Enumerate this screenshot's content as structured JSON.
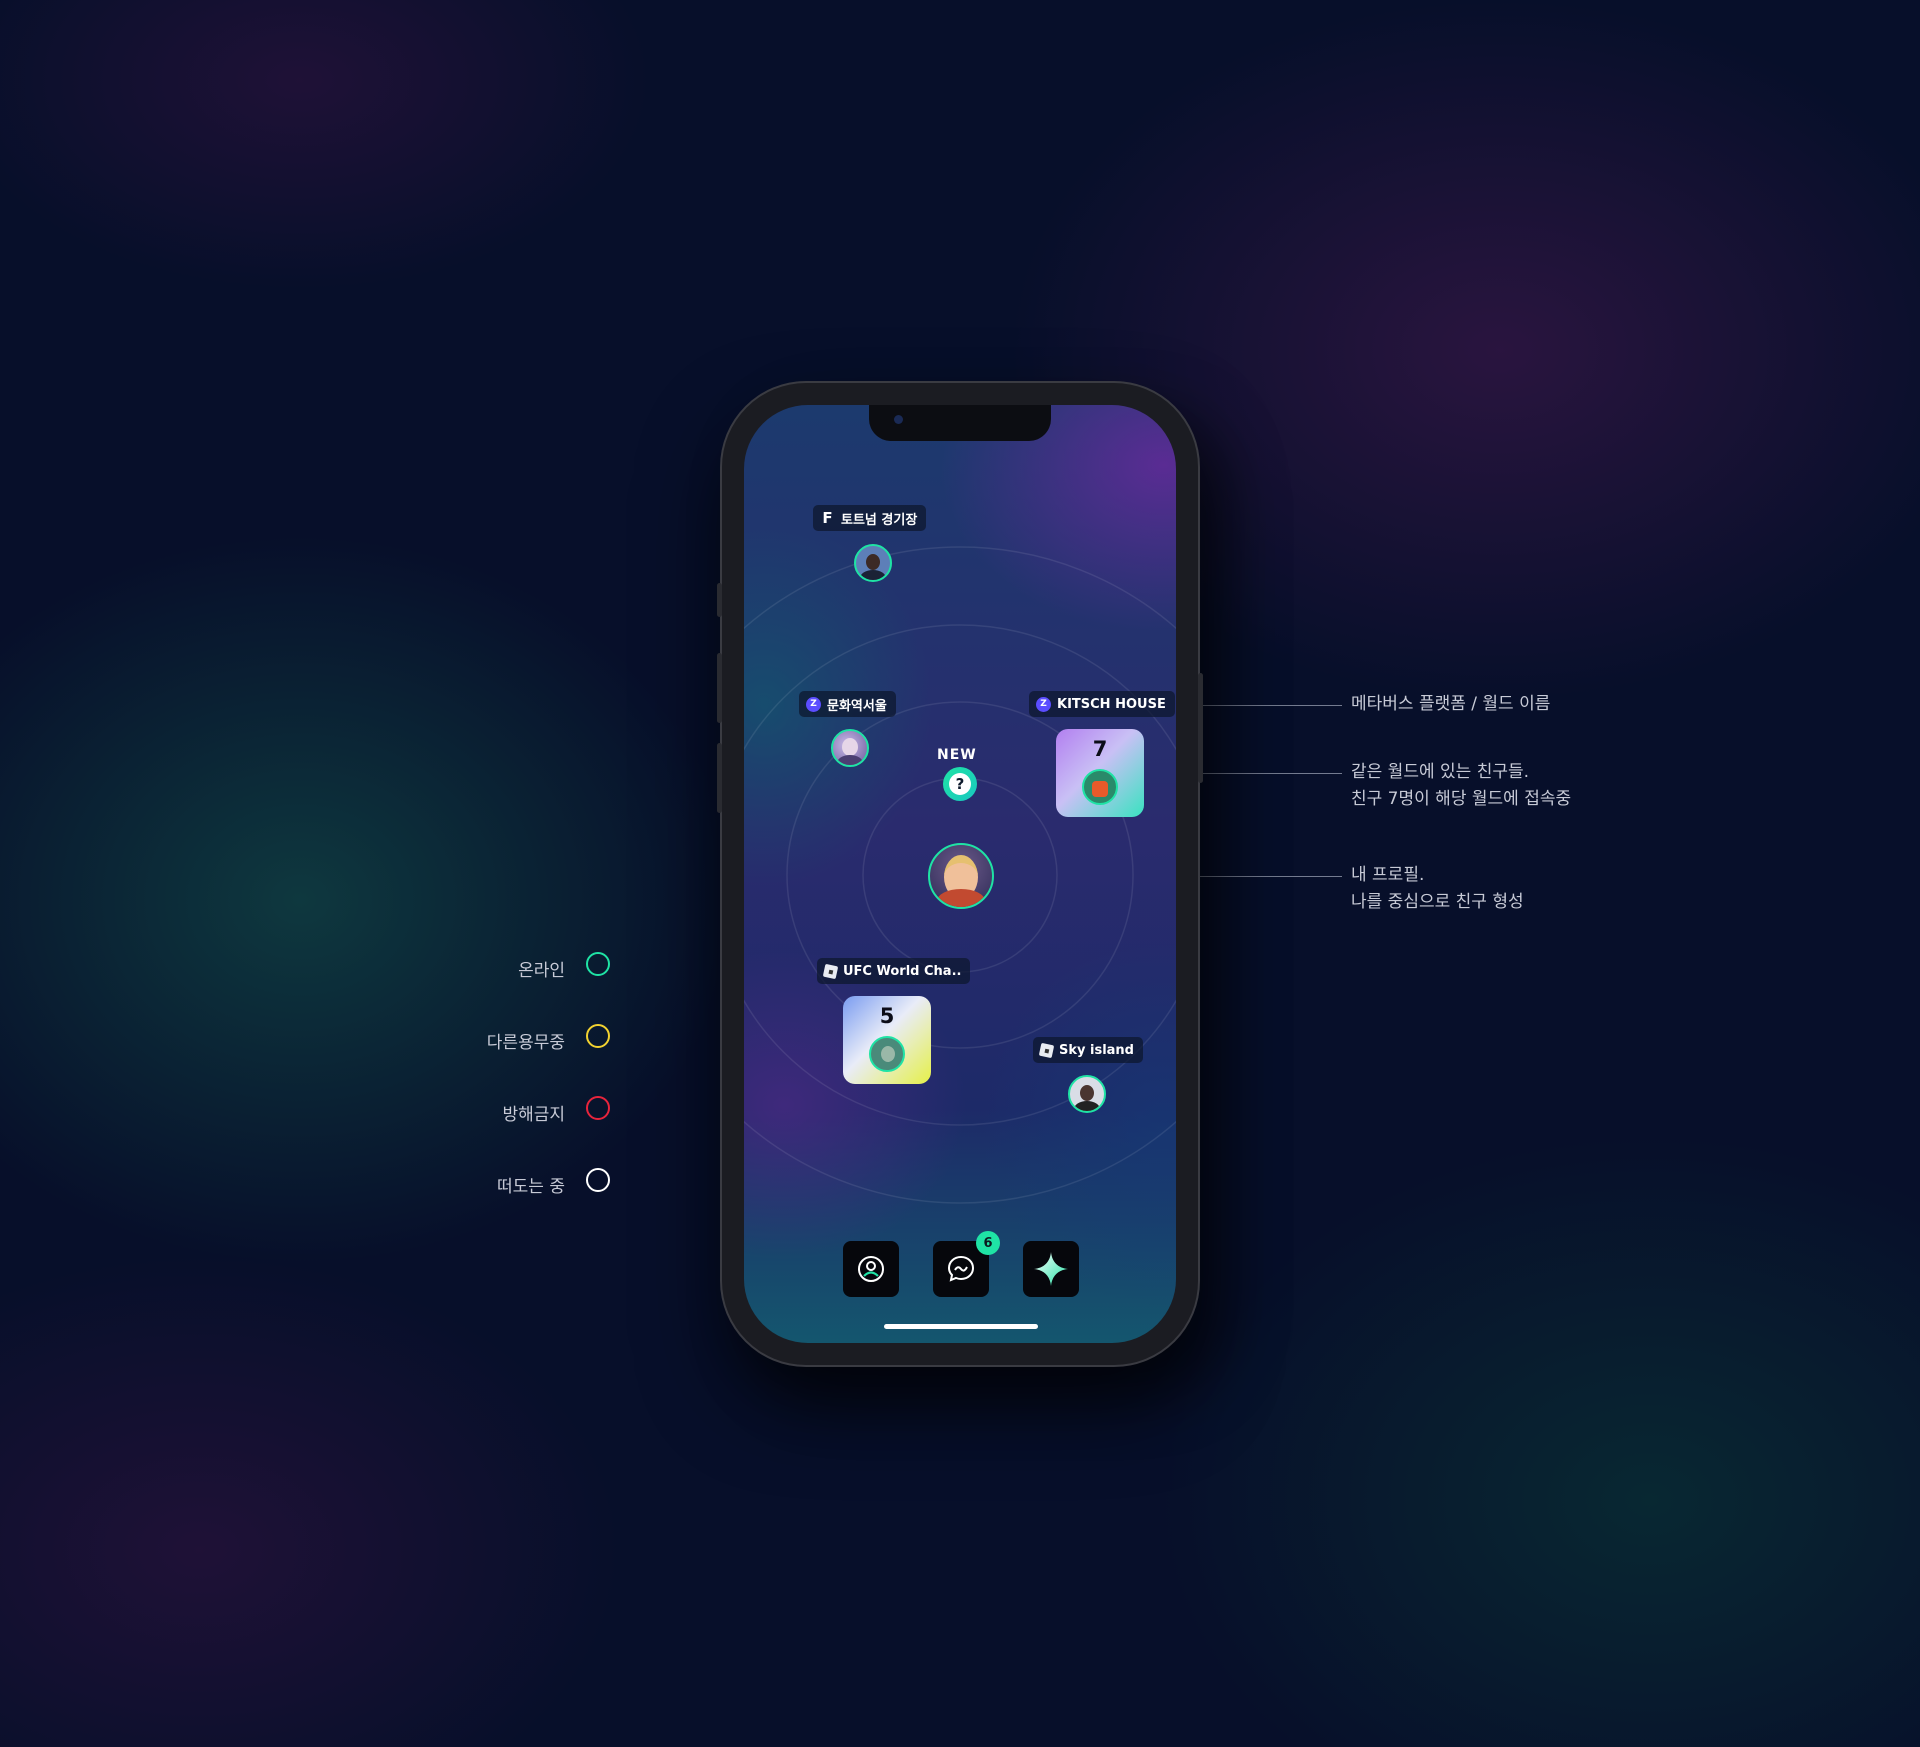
{
  "legend": [
    {
      "label": "온라인",
      "color": "#1fe3a5"
    },
    {
      "label": "다른용무중",
      "color": "#f2d230"
    },
    {
      "label": "방해금지",
      "color": "#e8243c"
    },
    {
      "label": "떠도는 중",
      "color": "#ffffff"
    }
  ],
  "annotations": {
    "world_name": "메타버스 플랫폼 / 월드 이름",
    "friends_line1": "같은 월드에 있는 친구들.",
    "friends_line2": "친구 7명이 해당 월드에 접속중",
    "profile_line1": "내 프로필.",
    "profile_line2": "나를 중심으로 친구 형성"
  },
  "worlds": {
    "tottenham": {
      "platform_icon": "fortnite-icon",
      "name": "토트넘 경기장"
    },
    "munhwa": {
      "platform_icon": "zepeto-icon",
      "name": "문화역서울"
    },
    "kitsch": {
      "platform_icon": "zepeto-icon",
      "name": "KITSCH HOUSE",
      "friend_count": "7"
    },
    "ufc": {
      "platform_icon": "roblox-icon",
      "name": "UFC World Cha..",
      "friend_count": "5"
    },
    "sky": {
      "platform_icon": "roblox-icon",
      "name": "Sky island"
    }
  },
  "new_world": {
    "label": "NEW",
    "symbol": "?"
  },
  "dock": {
    "profile_icon": "profile-icon",
    "chat_icon": "chat-icon",
    "chat_badge": "6",
    "sparkle_icon": "sparkle-icon"
  }
}
